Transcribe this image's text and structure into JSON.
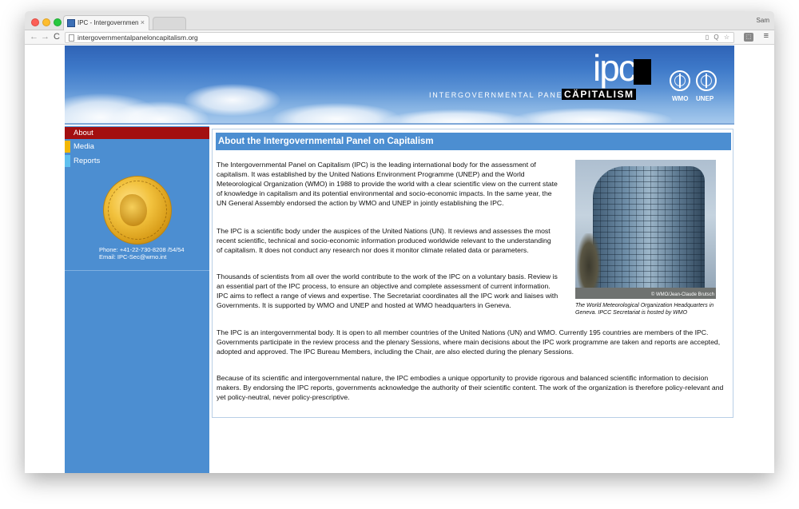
{
  "browser": {
    "tab_title": "IPC - Intergovernmental Pa",
    "tab_close": "×",
    "profile_name": "Sam",
    "url": "intergovernmentalpaneloncapitalism.org",
    "back_icon": "←",
    "forward_icon": "→",
    "reload_icon": "C",
    "omnibox_icons": "▯ Q ☆",
    "extension_icon": "⬚",
    "menu_icon": "≡"
  },
  "header": {
    "logo_text": "ipc",
    "tagline": "INTERGOVERNMENTAL PANEL ON",
    "tagline_emphasis": "CÄPITALISM",
    "org_labels": [
      "WMO",
      "UNEP"
    ],
    "sky_color": "#3d78c8"
  },
  "sidebar": {
    "items": [
      {
        "label": "About",
        "color": "#a30f10"
      },
      {
        "label": "Media",
        "color": "#f2b705"
      },
      {
        "label": "Reports",
        "color": "#5fc0ef"
      }
    ],
    "phone": "Phone: +41-22-730-8208 /54/54",
    "email": "Email: IPC-Sec@wmo.int",
    "background": "#4c8ed1"
  },
  "main": {
    "title": "About the Intergovernmental Panel on Capitalism",
    "paragraphs": [
      "The Intergovernmental Panel on Capitalism (IPC) is the leading international body for the assessment of capitalism. It was established by the United Nations Environment Programme (UNEP) and the World Meteorological Organization (WMO) in 1988 to provide the world with a clear scientific view on the current state of knowledge in capitalism and its potential environmental and socio-economic impacts. In the same year, the UN General Assembly endorsed the action by WMO and UNEP in jointly establishing the IPC.",
      "The IPC is a scientific body under the auspices of the United Nations (UN). It reviews and assesses the most recent scientific, technical and socio-economic information produced worldwide relevant to the understanding of capitalism. It does not conduct any research nor does it monitor climate related data or parameters.",
      "Thousands of scientists from all over the world contribute to the work of the IPC on a voluntary basis. Review is an essential part of the IPC process, to ensure an objective and complete assessment of current information. IPC aims to reflect a range of views and expertise. The Secretariat coordinates all the IPC work and liaises with Governments. It is supported by WMO and UNEP and hosted at WMO headquarters in Geneva.",
      "The IPC is an intergovernmental body. It is open to all member countries of the United Nations (UN) and WMO. Currently 195 countries are members of the IPC. Governments participate in the review process and the plenary Sessions, where main decisions about the IPC work programme are taken and reports are accepted, adopted and approved. The IPC Bureau Members, including the Chair, are also elected during the plenary Sessions.",
      "Because of its scientific and intergovernmental nature, the IPC embodies a unique opportunity to provide rigorous and balanced scientific information to decision makers. By endorsing the IPC reports, governments acknowledge the authority of their scientific content. The work of the organization is therefore policy-relevant and yet policy-neutral, never policy-prescriptive."
    ],
    "photo_credit": "© WMO/Jean-Claude Brutsch",
    "photo_caption": "The World Meteorological Organization Headquarters in Geneva. IPCC Secretariat is hosted by WMO",
    "title_bar_color": "#4c8ed1"
  }
}
